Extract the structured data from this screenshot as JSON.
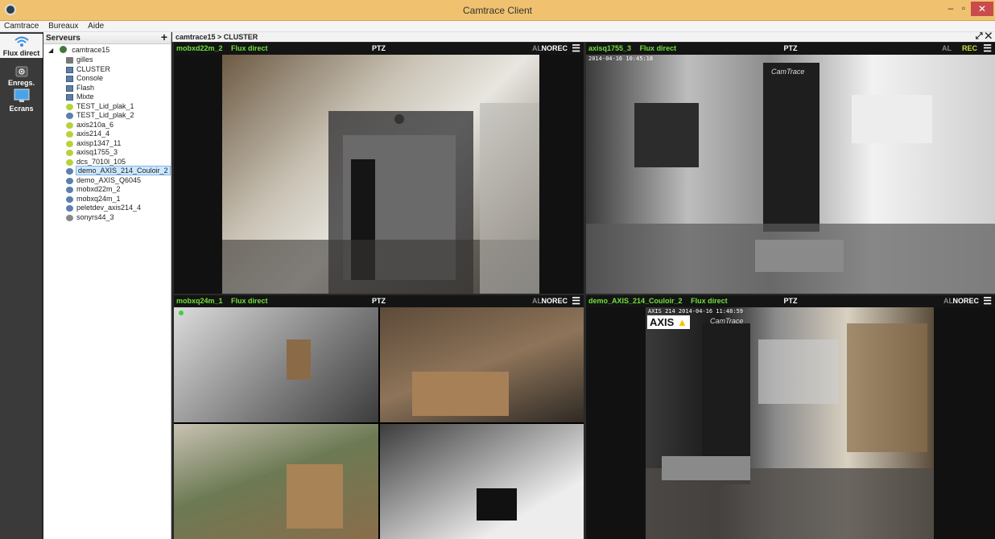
{
  "window": {
    "title": "Camtrace Client",
    "minimize": "–",
    "maximize": "▫",
    "close": "✕"
  },
  "menu": {
    "items": [
      "Camtrace",
      "Bureaux",
      "Aide"
    ]
  },
  "toolbar": {
    "flux": "Flux direct",
    "enreg": "Enregs.",
    "ecrans": "Ecrans"
  },
  "servers": {
    "header": "Serveurs",
    "add": "+",
    "root": "camtrace15",
    "nodes": [
      {
        "label": "gilles",
        "icon": "user-icon"
      },
      {
        "label": "CLUSTER",
        "icon": "server-icon"
      },
      {
        "label": "Console",
        "icon": "server-icon"
      },
      {
        "label": "Flash",
        "icon": "server-icon"
      },
      {
        "label": "Mixte",
        "icon": "server-icon"
      },
      {
        "label": "TEST_Lid_plak_1",
        "icon": "camera-live-icon"
      },
      {
        "label": "TEST_Lid_plak_2",
        "icon": "camera-rec-icon"
      },
      {
        "label": "axis210a_6",
        "icon": "camera-live-icon"
      },
      {
        "label": "axis214_4",
        "icon": "camera-live-icon"
      },
      {
        "label": "axisp1347_11",
        "icon": "camera-live-icon"
      },
      {
        "label": "axisq1755_3",
        "icon": "camera-live-icon"
      },
      {
        "label": "dcs_7010l_105",
        "icon": "camera-live-icon"
      },
      {
        "label": "demo_AXIS_214_Couloir_2",
        "icon": "camera-rec-icon",
        "selected": true
      },
      {
        "label": "demo_AXIS_Q6045",
        "icon": "camera-rec-icon"
      },
      {
        "label": "mobxd22m_2",
        "icon": "camera-rec-icon"
      },
      {
        "label": "mobxq24m_1",
        "icon": "camera-rec-icon"
      },
      {
        "label": "peletdev_axis214_4",
        "icon": "camera-rec-icon"
      },
      {
        "label": "sonyrs44_3",
        "icon": "camera-off-icon"
      }
    ]
  },
  "breadcrumb": "camtrace15 > CLUSTER",
  "tiles": [
    {
      "camera": "mobxd22m_2",
      "flux": "Flux direct",
      "ptz": "PTZ",
      "al": "AL",
      "rec": "NOREC",
      "rec_color": "#ffffff",
      "timestamp": ""
    },
    {
      "camera": "axisq1755_3",
      "flux": "Flux direct",
      "ptz": "PTZ",
      "al": "AL",
      "rec": "REC",
      "rec_color": "#c8e63a",
      "timestamp": "2014-04-16 10:45:18"
    },
    {
      "camera": "mobxq24m_1",
      "flux": "Flux direct",
      "ptz": "PTZ",
      "al": "AL",
      "rec": "NOREC",
      "rec_color": "#ffffff",
      "timestamp": ""
    },
    {
      "camera": "demo_AXIS_214_Couloir_2",
      "flux": "Flux direct",
      "ptz": "PTZ",
      "al": "AL",
      "rec": "NOREC",
      "rec_color": "#ffffff",
      "timestamp": "AXIS 214 2014-04-16 11:48:59"
    }
  ],
  "overlays": {
    "axis_logo": "AXIS",
    "camtrace_logo": "CamTrace"
  },
  "colors": {
    "titlebar": "#f0c270",
    "camera_label": "#6fe23a",
    "rec_on": "#c8e63a",
    "selection": "#cde8ff"
  }
}
